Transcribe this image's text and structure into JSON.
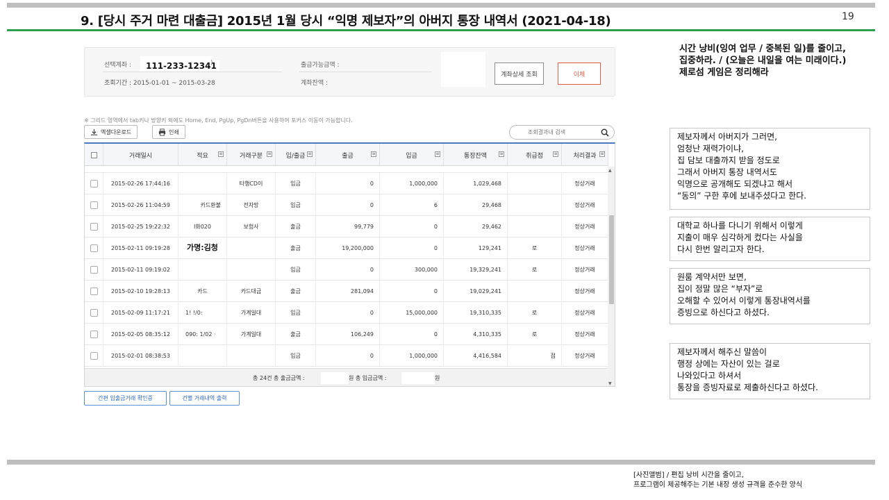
{
  "slide": {
    "title": "9. [당시 주거 마련 대출금] 2015년 1월 당시 “익명 제보자”의 아버지 통장 내역서 (2021-04-18)",
    "page_number": "19"
  },
  "account": {
    "account_label": "선택계좌 :",
    "account_number": "111-233-12341",
    "account_suffix": ")",
    "period": "조회기간 : 2015-01-01 ~ 2015-03-28",
    "available_label": "출금가능금액 :",
    "balance_label": "계좌잔액 :",
    "detail_button": "계좌상세 조회",
    "transfer_button": "이체"
  },
  "grid_note": "※ 그리드 영역에서 tab키나 방향키 외에도 Home, End, PgUp, PgDn버튼을 사용하여 포커스 이동이 가능합니다.",
  "toolbar": {
    "excel_label": "엑셀다운로드",
    "print_label": "인쇄",
    "search_placeholder": "조회결과내 검색"
  },
  "table": {
    "headers": [
      "거래일시",
      "적요",
      "거래구분",
      "입/출금",
      "출금",
      "입금",
      "통장잔액",
      "취급점",
      "처리결과"
    ],
    "rows": [
      {
        "datetime": "2015-02-26 17:44:16",
        "memo": "",
        "type": "타행CD이",
        "io": "입금",
        "withdraw": "0",
        "deposit": "1,000,000",
        "balance": "1,029,468",
        "branch": "",
        "result": "정상거래"
      },
      {
        "datetime": "2015-02-26 11:04:59",
        "memo": "카드환불",
        "type": "전자망",
        "io": "입금",
        "withdraw": "0",
        "deposit": "6",
        "balance": "29,468",
        "branch": "",
        "result": "정상거래"
      },
      {
        "datetime": "2015-02-25 19:22:32",
        "memo": "I화020",
        "type": "보험사",
        "io": "출금",
        "withdraw": "99,779",
        "deposit": "0",
        "balance": "29,462",
        "branch": "",
        "result": "정상거래"
      },
      {
        "datetime": "2015-02-11 09:19:28",
        "memo": "가명:김청",
        "type": "",
        "io": "출금",
        "withdraw": "19,200,000",
        "deposit": "0",
        "balance": "129,241",
        "branch": "로",
        "result": "정상거래"
      },
      {
        "datetime": "2015-02-11 09:19:02",
        "memo": "",
        "type": "",
        "io": "입금",
        "withdraw": "0",
        "deposit": "300,000",
        "balance": "19,329,241",
        "branch": "로",
        "result": "정상거래"
      },
      {
        "datetime": "2015-02-10 19:28:13",
        "memo": "카드",
        "type": "카드대금",
        "io": "출금",
        "withdraw": "281,094",
        "deposit": "0",
        "balance": "19,029,241",
        "branch": "",
        "result": "정상거래"
      },
      {
        "datetime": "2015-02-09 11:17:21",
        "memo": "1!  !/0:",
        "type": "가계일대",
        "io": "입금",
        "withdraw": "0",
        "deposit": "15,000,000",
        "balance": "19,310,335",
        "branch": "로",
        "result": "정상거래"
      },
      {
        "datetime": "2015-02-05 08:35:12",
        "memo": "090:  1/02  ·",
        "type": "가계일대",
        "io": "출금",
        "withdraw": "106,249",
        "deposit": "0",
        "balance": "4,310,335",
        "branch": "로",
        "result": "정상거래"
      },
      {
        "datetime": "2015-02-01 08:38:53",
        "memo": "",
        "type": "",
        "io": "입금",
        "withdraw": "0",
        "deposit": "1,000,000",
        "balance": "4,416,584",
        "branch": "점",
        "result": "정상거래"
      }
    ],
    "footer_total": "총 24건 총 출금금액 :",
    "footer_mid": "원 총 입금금액 :",
    "footer_end": "원"
  },
  "bottom_buttons": {
    "confirm": "간편 입출금거래 확인증",
    "print_each": "건별 거래내역 출력"
  },
  "side": {
    "heading_lines": [
      "시간 낭비(잉여 업무 / 중복된 일)를 줄이고,",
      "집중하라. / (오늘은 내일을 여는 미래이다.)",
      "제로섬 게임은 정리해라"
    ],
    "note1": [
      "제보자께서 아버지가 그러면,",
      "엄청난 재력가이냐,",
      "집 담보 대출까지 받을 정도로",
      "그래서 아버지 통장 내역서도",
      "익명으로 공개해도 되겠냐고 해서",
      "“동의” 구한 후에 보내주셨다고 한다."
    ],
    "note2": [
      "대학교 하나를 다니기 위해서 이렇게",
      "지출이 매우 심각하게 컸다는 사실을",
      "다시 한번 알리고자 한다."
    ],
    "note3": [
      "원룸 계약서만 보면,",
      "집이 정말 많은 “부자”로",
      "오해할 수 있어서 이렇게 통장내역서를",
      "증빙으로 하신다고 하셨다."
    ],
    "note4": [
      "제보자께서 해주신 말씀이",
      "행정 상에는 자산이 있는 걸로",
      "나와있다고 하셔서",
      "통장을 증빙자료로 제출하신다고 하셨다."
    ]
  },
  "footer": {
    "line1": "[사진앨범] / 편집 낭비 시간을 줄이고,",
    "line2": "프로그램이 제공해주는 기본 내장 생성 규격을 준수한 양식"
  },
  "colors": {
    "accent_green": "#2e9e4f",
    "table_blue": "#4a78c2",
    "transfer_red": "#e05a4a",
    "bar_gray": "#bfbfbf"
  }
}
